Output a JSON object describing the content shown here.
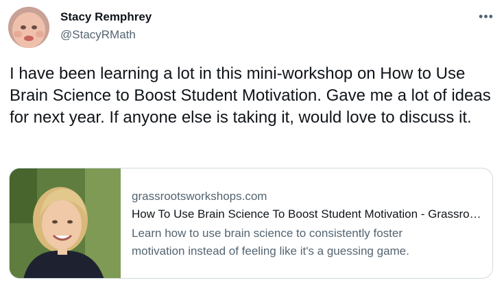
{
  "tweet": {
    "author": {
      "name": "Stacy Remphrey",
      "handle": "@StacyRMath",
      "avatar_icon": "avatar-photo"
    },
    "more_icon": "more-options-icon",
    "more_glyph": "•••",
    "text": "I have been learning a lot in this mini-workshop on How to Use Brain Science to Boost Student Motivation. Gave me a lot of ideas for next year. If anyone else is taking it, would love to discuss it."
  },
  "link_card": {
    "domain": "grassrootsworkshops.com",
    "title": "How To Use Brain Science To Boost Student Motivation - Grassroots Workshops",
    "description": "Learn how to use brain science to consistently foster motivation instead of feeling like it's a guessing game.",
    "thumbnail_icon": "article-thumbnail-photo"
  },
  "colors": {
    "text_primary": "#0f1419",
    "text_secondary": "#536471",
    "border": "#cfd9de"
  }
}
